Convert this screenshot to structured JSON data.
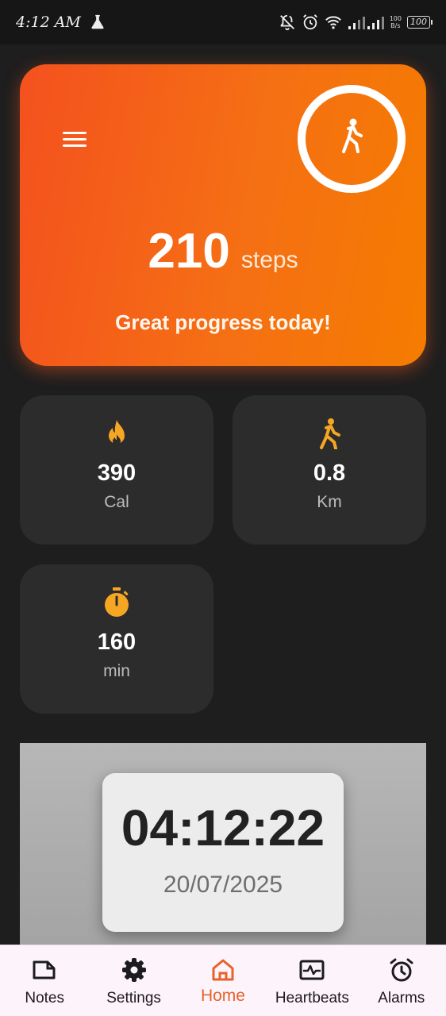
{
  "status_bar": {
    "time": "4:12 AM",
    "net_speed_value": "100",
    "net_speed_unit": "B/s",
    "battery": "100"
  },
  "hero": {
    "steps_value": "210",
    "steps_unit": "steps",
    "message": "Great progress today!"
  },
  "stats": [
    {
      "icon": "fire-icon",
      "value": "390",
      "unit": "Cal"
    },
    {
      "icon": "walking-icon",
      "value": "0.8",
      "unit": "Km"
    },
    {
      "icon": "stopwatch-icon",
      "value": "160",
      "unit": "min"
    }
  ],
  "clock": {
    "time": "04:12:22",
    "date": "20/07/2025"
  },
  "bottom_nav": [
    {
      "label": "Notes",
      "icon": "notes-icon",
      "active": false
    },
    {
      "label": "Settings",
      "icon": "gear-icon",
      "active": false
    },
    {
      "label": "Home",
      "icon": "home-icon",
      "active": true
    },
    {
      "label": "Heartbeats",
      "icon": "heartbeat-icon",
      "active": false
    },
    {
      "label": "Alarms",
      "icon": "alarm-icon",
      "active": false
    }
  ],
  "colors": {
    "accent": "#f57c00",
    "hero_start": "#f4511e",
    "stat_icon": "#f5a623",
    "nav_active": "#e8622a",
    "background": "#1e1e1e",
    "card": "#2c2c2c"
  }
}
